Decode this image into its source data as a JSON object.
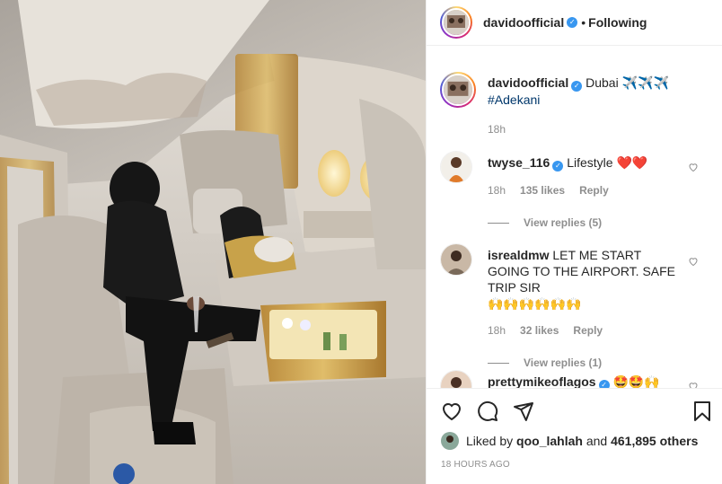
{
  "post": {
    "author": "davidoofficial",
    "following_label": "Following",
    "dot": "•"
  },
  "caption": {
    "author": "davidoofficial",
    "text": "Dubai",
    "emoji": "✈️✈️✈️",
    "hashtag": "#Adekani",
    "time": "18h"
  },
  "comments": [
    {
      "author": "twyse_116",
      "verified": true,
      "text": "Lifestyle",
      "emoji": "❤️❤️",
      "time": "18h",
      "likes": "135 likes",
      "reply": "Reply",
      "view_replies": "View replies (5)"
    },
    {
      "author": "isrealdmw",
      "verified": false,
      "text": "LET ME START GOING TO THE AIRPORT. SAFE TRIP SIR",
      "emoji": "🙌🙌🙌🙌🙌🙌",
      "time": "18h",
      "likes": "32 likes",
      "reply": "Reply",
      "view_replies": "View replies (1)"
    },
    {
      "author": "prettymikeoflagos",
      "verified": true,
      "text": "",
      "emoji": "🤩🤩🙌"
    }
  ],
  "likes": {
    "prefix": "Liked by",
    "user": "qoo_lahlah",
    "and": "and",
    "count": "461,895 others"
  },
  "timestamp": "18 HOURS AGO",
  "icons": [
    "heart-icon",
    "comment-icon",
    "share-icon",
    "bookmark-icon",
    "verified-badge-icon"
  ],
  "colors": {
    "verified": "#3897f0",
    "muted": "#8e8e8e",
    "heart_red": "#ed4956",
    "hashtag": "#00376b"
  }
}
